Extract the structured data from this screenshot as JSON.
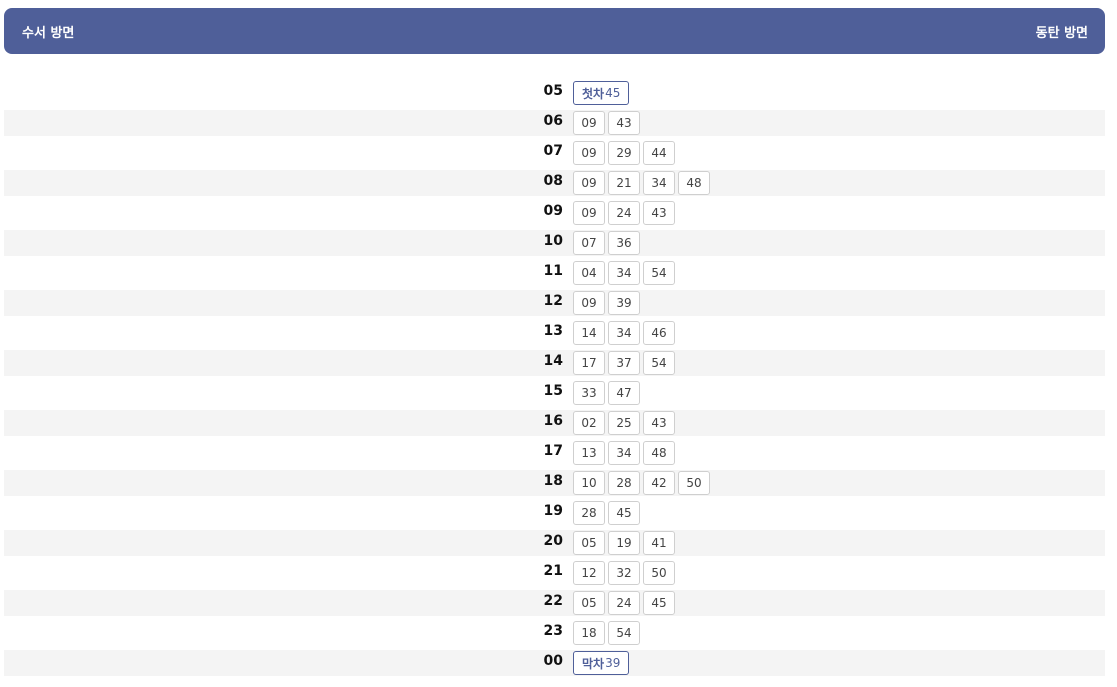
{
  "header": {
    "left_label": "수서 방면",
    "right_label": "동탄 방면"
  },
  "colors": {
    "header_bg": "#4f5f99",
    "row_alt_bg": "#f4f4f4",
    "special_border": "#4f5f99"
  },
  "rows": [
    {
      "hour": "05",
      "minutes": [
        {
          "tag": "첫차",
          "value": "45"
        }
      ]
    },
    {
      "hour": "06",
      "minutes": [
        "09",
        "43"
      ]
    },
    {
      "hour": "07",
      "minutes": [
        "09",
        "29",
        "44"
      ]
    },
    {
      "hour": "08",
      "minutes": [
        "09",
        "21",
        "34",
        "48"
      ]
    },
    {
      "hour": "09",
      "minutes": [
        "09",
        "24",
        "43"
      ]
    },
    {
      "hour": "10",
      "minutes": [
        "07",
        "36"
      ]
    },
    {
      "hour": "11",
      "minutes": [
        "04",
        "34",
        "54"
      ]
    },
    {
      "hour": "12",
      "minutes": [
        "09",
        "39"
      ]
    },
    {
      "hour": "13",
      "minutes": [
        "14",
        "34",
        "46"
      ]
    },
    {
      "hour": "14",
      "minutes": [
        "17",
        "37",
        "54"
      ]
    },
    {
      "hour": "15",
      "minutes": [
        "33",
        "47"
      ]
    },
    {
      "hour": "16",
      "minutes": [
        "02",
        "25",
        "43"
      ]
    },
    {
      "hour": "17",
      "minutes": [
        "13",
        "34",
        "48"
      ]
    },
    {
      "hour": "18",
      "minutes": [
        "10",
        "28",
        "42",
        "50"
      ]
    },
    {
      "hour": "19",
      "minutes": [
        "28",
        "45"
      ]
    },
    {
      "hour": "20",
      "minutes": [
        "05",
        "19",
        "41"
      ]
    },
    {
      "hour": "21",
      "minutes": [
        "12",
        "32",
        "50"
      ]
    },
    {
      "hour": "22",
      "minutes": [
        "05",
        "24",
        "45"
      ]
    },
    {
      "hour": "23",
      "minutes": [
        "18",
        "54"
      ]
    },
    {
      "hour": "00",
      "minutes": [
        {
          "tag": "막차",
          "value": "39"
        }
      ]
    }
  ]
}
